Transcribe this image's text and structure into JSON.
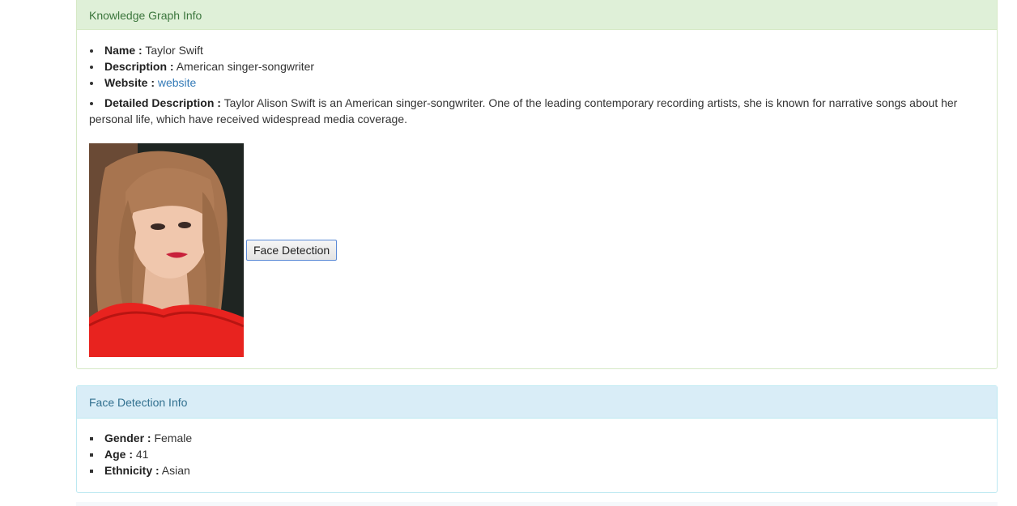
{
  "knowledge_panel": {
    "title": "Knowledge Graph Info",
    "name_label": "Name :",
    "name_value": "Taylor Swift",
    "description_label": "Description :",
    "description_value": "American singer-songwriter",
    "website_label": "Website :",
    "website_link": "website",
    "detailed_label": "Detailed Description :",
    "detailed_value": "Taylor Alison Swift is an American singer-songwriter. One of the leading contemporary recording artists, she is known for narrative songs about her personal life, which have received widespread media coverage.",
    "face_detection_button": "Face Detection"
  },
  "face_panel": {
    "title": "Face Detection Info",
    "gender_label": "Gender :",
    "gender_value": "Female",
    "age_label": "Age :",
    "age_value": "41",
    "ethnicity_label": "Ethnicity :",
    "ethnicity_value": "Asian"
  },
  "colors": {
    "success_bg": "#dff0d8",
    "success_text": "#3c763d",
    "info_bg": "#d9edf7",
    "info_text": "#31708f",
    "link": "#337ab7"
  }
}
